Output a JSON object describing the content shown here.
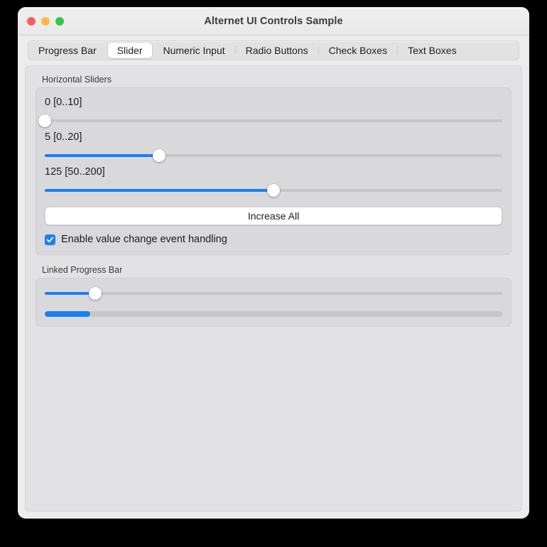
{
  "window": {
    "title": "Alternet UI Controls Sample",
    "traffic_lights": [
      {
        "name": "close",
        "color": "#fc6058"
      },
      {
        "name": "minimize",
        "color": "#fdbc40"
      },
      {
        "name": "zoom",
        "color": "#34c749"
      }
    ]
  },
  "tabs": {
    "selected": "Slider",
    "items": [
      {
        "label": "Progress Bar",
        "selected": false
      },
      {
        "label": "Slider",
        "selected": true
      },
      {
        "label": "Numeric Input",
        "selected": false
      },
      {
        "label": "Radio Buttons",
        "selected": false
      },
      {
        "label": "Check Boxes",
        "selected": false
      },
      {
        "label": "Text Boxes",
        "selected": false
      }
    ]
  },
  "colors": {
    "accent": "#1a7ef5",
    "track": "#c6c6c9",
    "group_bg": "#d9d9dc",
    "content_bg": "#e2e2e4"
  },
  "horizontal_sliders": {
    "group_label": "Horizontal Sliders",
    "sliders": [
      {
        "value_label": "0 [0..10]",
        "value": 0,
        "min": 0,
        "max": 10,
        "percent": 0
      },
      {
        "value_label": "5 [0..20]",
        "value": 5,
        "min": 0,
        "max": 20,
        "percent": 25
      },
      {
        "value_label": "125 [50..200]",
        "value": 125,
        "min": 50,
        "max": 200,
        "percent": 50
      }
    ],
    "increase_all_label": "Increase All",
    "checkbox": {
      "label": "Enable value change event handling",
      "checked": true
    }
  },
  "linked_progress_bar": {
    "group_label": "Linked Progress Bar",
    "slider": {
      "value": 11,
      "min": 0,
      "max": 100,
      "percent": 11
    },
    "progress": {
      "value": 10,
      "min": 0,
      "max": 100,
      "percent": 10
    }
  }
}
